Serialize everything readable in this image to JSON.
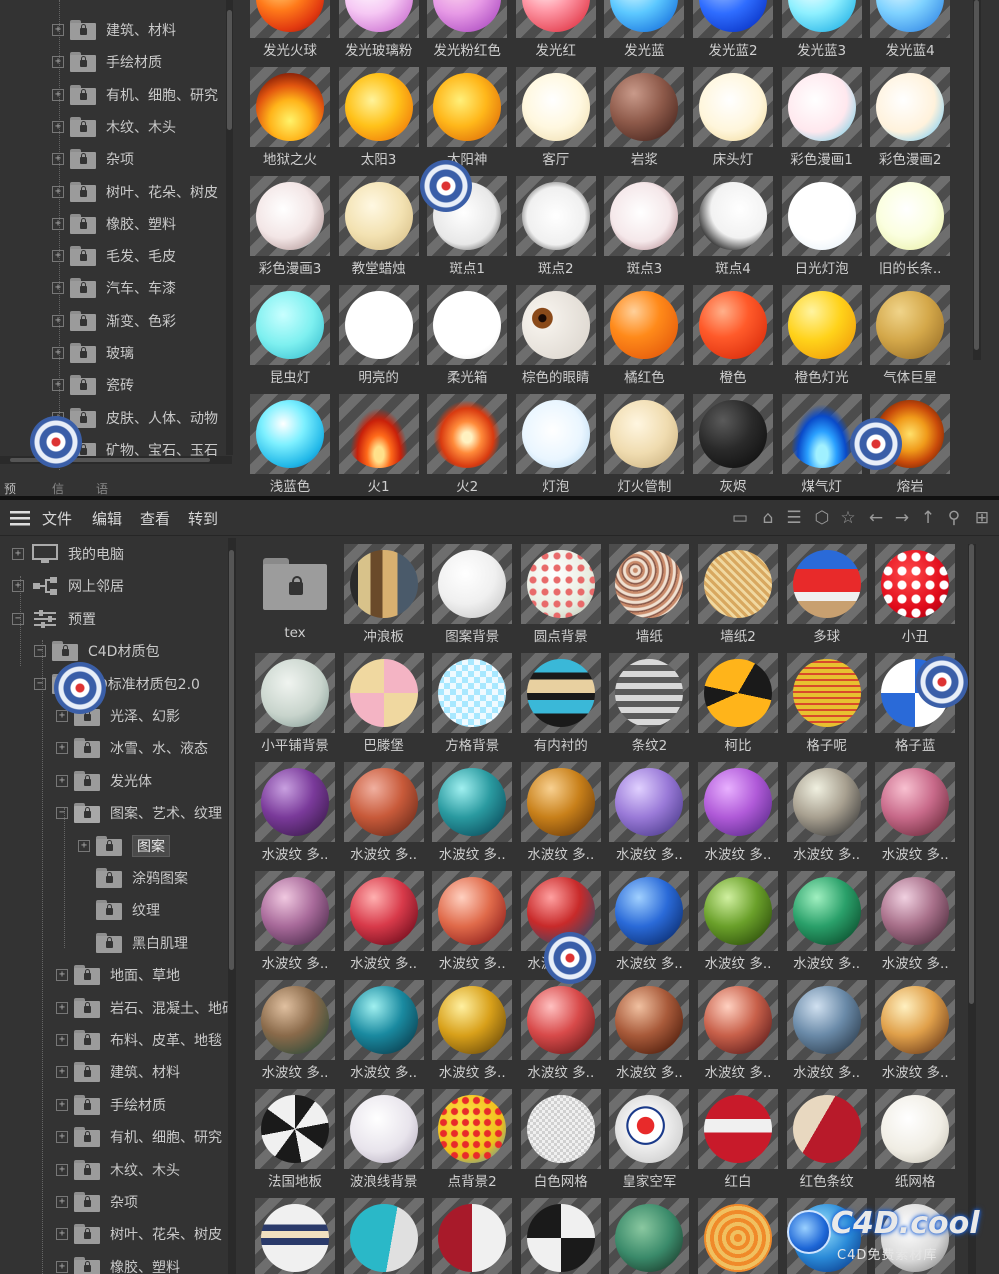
{
  "top": {
    "tree_items": [
      "建筑、材料",
      "手绘材质",
      "有机、细胞、研究",
      "木纹、木头",
      "杂项",
      "树叶、花朵、树皮",
      "橡胶、塑料",
      "毛发、毛皮",
      "汽车、车漆",
      "渐变、色彩",
      "玻璃",
      "瓷砖",
      "皮肤、人体、动物",
      "矿物、宝石、玉石"
    ],
    "bottom_tabs": [
      "预览",
      "信息",
      "语言"
    ],
    "materials": [
      {
        "label": "发光火球",
        "style": "radial-gradient(circle at 35% 30%,#ffe08a,#ff7a1a 40%,#e23a10 70%,#8a1005)"
      },
      {
        "label": "发光玻璃粉",
        "style": "radial-gradient(circle at 35% 30%,#fff,#f6c8f4 45%,#d27ed6 80%)"
      },
      {
        "label": "发光粉红色",
        "style": "radial-gradient(circle at 35% 30%,#fde,#e79ae6 45%,#b85bc8 80%)"
      },
      {
        "label": "发光红",
        "style": "radial-gradient(circle at 35% 30%,#fff,#ff9aa8 40%,#e23a4a 85%)"
      },
      {
        "label": "发光蓝",
        "style": "radial-gradient(circle at 35% 30%,#e8ffff,#5cc8ff 45%,#1c78e0 85%)"
      },
      {
        "label": "发光蓝2",
        "style": "radial-gradient(circle at 35% 30%,#a9c8ff,#2f6dff 45%,#0b36c8 85%)"
      },
      {
        "label": "发光蓝3",
        "style": "radial-gradient(circle at 35% 30%,#ffffff,#8ff0ff 45%,#2bb6e8 85%)"
      },
      {
        "label": "发光蓝4",
        "style": "radial-gradient(circle at 35% 30%,#e9fbff,#7fd2ff 45%,#3a8fe8 85%)"
      },
      {
        "label": "地狱之火",
        "style": "radial-gradient(circle at 50% 70%,#fff36a,#ffb41a 35%,#e2560f 60%,#6a0e05 90%)"
      },
      {
        "label": "太阳3",
        "style": "radial-gradient(circle at 40% 40%,#fff39a,#ffc21a 45%,#f07a0a 85%)"
      },
      {
        "label": "太阳神",
        "style": "radial-gradient(circle at 40% 40%,#fff07a,#ffb71a 45%,#e0700a 85%)"
      },
      {
        "label": "客厅",
        "style": "radial-gradient(circle at 45% 40%,#ffffff,#fff8e0 50%,#f2e2b8 85%)"
      },
      {
        "label": "岩浆",
        "style": "radial-gradient(circle at 35% 30%,#c99a8a,#8e5a4a 45%,#4e2a22 85%)"
      },
      {
        "label": "床头灯",
        "style": "radial-gradient(circle at 45% 40%,#ffffff,#fff6dc 55%,#f3dca0 90%)"
      },
      {
        "label": "彩色漫画1",
        "style": "radial-gradient(circle at 40% 40%,#ffffff,#ffe8ee 55%,#9ed7e8 80%,#ffb37a 90%)"
      },
      {
        "label": "彩色漫画2",
        "style": "radial-gradient(circle at 40% 40%,#ffffff,#fff2dc 55%,#9fd8f0 80%,#6aa8e8 90%)"
      },
      {
        "label": "彩色漫画3",
        "style": "radial-gradient(circle at 40% 40%,#ffffff,#f3e6e6 50%,#cdb8b8 72%,#4fc4c8 88%)"
      },
      {
        "label": "教堂蜡烛",
        "style": "radial-gradient(circle at 40% 35%,#fff8e2,#f3e2b2 50%,#d8c08a 88%)"
      },
      {
        "label": "斑点1",
        "style": "radial-gradient(circle at 45% 45%,#ffffff,#e8e8e8 60%,#2a2a2a 95%)"
      },
      {
        "label": "斑点2",
        "style": "radial-gradient(circle at 50% 50%,#ffffff,#f0f0f0 60%,#1a1a1a 95%)"
      },
      {
        "label": "斑点3",
        "style": "radial-gradient(circle at 45% 45%,#ffffff,#f5e8ea 55%,#b48a90 90%)"
      },
      {
        "label": "斑点4",
        "style": "radial-gradient(circle at 60% 40%,#ffffff,#f2f2f2 50%,#1e1e1e 80%)"
      },
      {
        "label": "日光灯泡",
        "style": "radial-gradient(circle at 45% 40%,#ffffff,#ffffff 55%,#e6f0f8 90%)"
      },
      {
        "label": "旧的长条..",
        "style": "radial-gradient(circle at 45% 40%,#ffffff,#fbffe0 50%,#e9f0a8 90%)"
      },
      {
        "label": "昆虫灯",
        "style": "radial-gradient(circle at 40% 35%,#c8ffff,#7ef0f0 50%,#3ac0d0 90%)"
      },
      {
        "label": "明亮的",
        "style": "radial-gradient(circle at 45% 40%,#ffffff,#ffffff 70%,#e8e8e8 95%)"
      },
      {
        "label": "柔光箱",
        "style": "radial-gradient(circle at 45% 40%,#ffffff,#ffffff 65%,#e2e2e2 95%)"
      },
      {
        "label": "棕色的眼睛",
        "style": "radial-gradient(circle at 30% 40%,#1a0a05 0 6%,#8a4a1a 7% 16%,#f4f0ea 17%,#dcd6ce 90%)"
      },
      {
        "label": "橘红色",
        "style": "radial-gradient(circle at 35% 30%,#ffd09a,#ff8a1a 40%,#e2560a 90%)"
      },
      {
        "label": "橙色",
        "style": "radial-gradient(circle at 35% 30%,#ffb08a,#ff5a2a 40%,#d82a0a 90%)"
      },
      {
        "label": "橙色灯光",
        "style": "radial-gradient(circle at 35% 30%,#fff4a0,#ffd21a 45%,#f09a0a 90%)"
      },
      {
        "label": "气体巨星",
        "style": "radial-gradient(circle at 35% 30%,#f0d48a,#d4a84a 45%,#9a7028 90%)"
      },
      {
        "label": "浅蓝色",
        "style": "radial-gradient(circle at 40% 35%,#ffffff,#7ef0ff 35%,#22b8e8 70%,#0a6ab8 95%)"
      },
      {
        "label": "火1",
        "style": "radial-gradient(ellipse at 50% 80%,#ffe08a 0 10%,#ff6a1a 25%,#c8200a 45%,transparent 60%)"
      },
      {
        "label": "火2",
        "style": "radial-gradient(ellipse at 50% 55%,#fff1c0 0 10%,#ff8a3a 30%,#d83a10 55%,transparent 70%)"
      },
      {
        "label": "灯泡",
        "style": "radial-gradient(circle at 45% 45%,#ffffff,#eaf6ff 55%,#b8d8f0 90%)"
      },
      {
        "label": "灯火管制",
        "style": "radial-gradient(circle at 40% 35%,#fff6e0,#f0dcb0 50%,#cdb483 90%)"
      },
      {
        "label": "灰烬",
        "style": "radial-gradient(circle at 35% 30%,#5a5a5a,#2a2a2a 45%,#0e0e0e 90%)"
      },
      {
        "label": "煤气灯",
        "style": "radial-gradient(ellipse at 50% 80%,#a0f0ff 0 12%,#2aa0ff 30%,#0a4ac8 50%,transparent 65%)"
      },
      {
        "label": "熔岩",
        "style": "radial-gradient(circle at 50% 50%,#ffe06a,#f09a1a 35%,#c84a0a 60%,#5a1a05 90%)"
      }
    ]
  },
  "menubar": {
    "items": [
      "文件",
      "编辑",
      "查看",
      "转到"
    ],
    "tool_icons": [
      "window-icon",
      "home-icon",
      "filter-icon",
      "cube-icon",
      "star-icon",
      "back-arrow-icon",
      "forward-arrow-icon",
      "up-arrow-icon",
      "search-icon",
      "add-icon"
    ],
    "tool_glyphs": [
      "▭",
      "⌂",
      "☰",
      "⬡",
      "☆",
      "←",
      "→",
      "↑",
      "⚲",
      "⊞"
    ]
  },
  "bottom": {
    "tree": [
      {
        "label": "我的电脑",
        "kind": "computer"
      },
      {
        "label": "网上邻居",
        "kind": "network"
      },
      {
        "label": "预置",
        "kind": "preset"
      },
      {
        "label": "C4D材质包",
        "kind": "folder"
      },
      {
        "label": "4D标准材质包2.0",
        "kind": "folder"
      },
      {
        "label": "光泽、幻影",
        "kind": "folder"
      },
      {
        "label": "冰雪、水、液态",
        "kind": "folder"
      },
      {
        "label": "发光体",
        "kind": "folder"
      },
      {
        "label": "图案、艺术、纹理",
        "kind": "folder-open"
      },
      {
        "label": "图案",
        "kind": "folder",
        "selected": true
      },
      {
        "label": "涂鸦图案",
        "kind": "folder"
      },
      {
        "label": "纹理",
        "kind": "folder"
      },
      {
        "label": "黑白肌理",
        "kind": "folder"
      },
      {
        "label": "地面、草地",
        "kind": "folder"
      },
      {
        "label": "岩石、混凝土、地砖",
        "kind": "folder"
      },
      {
        "label": "布料、皮革、地毯",
        "kind": "folder"
      },
      {
        "label": "建筑、材料",
        "kind": "folder"
      },
      {
        "label": "手绘材质",
        "kind": "folder"
      },
      {
        "label": "有机、细胞、研究",
        "kind": "folder"
      },
      {
        "label": "木纹、木头",
        "kind": "folder"
      },
      {
        "label": "杂项",
        "kind": "folder"
      },
      {
        "label": "树叶、花朵、树皮",
        "kind": "folder"
      },
      {
        "label": "橡胶、塑料",
        "kind": "folder"
      }
    ],
    "materials": [
      {
        "label": "tex",
        "folder": true
      },
      {
        "label": "冲浪板",
        "style": "linear-gradient(90deg,#2a2a2a 0 12%,#d8c28a 12% 30%,#6a4a2a 30% 48%,#d8b070 48% 70%,#4a5a6a 70%)"
      },
      {
        "label": "图案背景",
        "style": "radial-gradient(circle at 40% 35%,#ffffff,#f0f0f0 50%,#c8c8c8 90%)"
      },
      {
        "label": "圆点背景",
        "style": "radial-gradient(circle,#e86a6a 0 3px,transparent 4px) 0 0/12px 12px,radial-gradient(circle at 40% 35%,#fff,#e8ece0 60%,#b8c0b0)"
      },
      {
        "label": "墙纸",
        "style": "repeating-radial-gradient(circle at 30% 30%,#c88a6a 0 2px,#f0e0d0 3px 5px,#8a5a4a 6px 7px)"
      },
      {
        "label": "墙纸2",
        "style": "repeating-linear-gradient(45deg,#d8a860 0 3px,#f0d8a0 3px 6px),repeating-linear-gradient(-45deg,#a87030 0 3px,transparent 3px 6px)"
      },
      {
        "label": "多球",
        "style": "linear-gradient(180deg,#2a6ad8 0 28%,#e82a2a 28% 62%,#f0f0f0 62% 75%,#c8a070 75%)"
      },
      {
        "label": "小丑",
        "style": "radial-gradient(circle,#ffffff 0 4px,transparent 5px) 0 0/14px 14px,radial-gradient(circle at 40% 35%,#ff4a4a,#e00a1a 60%,#900010)"
      },
      {
        "label": "小平铺背景",
        "style": "radial-gradient(circle at 40% 35%,#f0f4f0,#c8d4cc 55%,#8aa09a 90%)"
      },
      {
        "label": "巴滕堡",
        "style": "conic-gradient(#f4b4c4 0 25%,#f0d8a0 25% 50%,#f4b4c4 50% 75%,#f0d8a0 75%)"
      },
      {
        "label": "方格背景",
        "style": "repeating-conic-gradient(#a8e8ff 0 25%,#f0faff 0 50%) 0 0/12px 12px"
      },
      {
        "label": "有内衬的",
        "style": "linear-gradient(180deg,#3ab8d8 0 20%,#1a1a1a 20% 30%,#e8d0a0 30% 50%,#1a1a1a 50% 60%,#3ab8d8 60% 80%,#1a1a1a 80%)"
      },
      {
        "label": "条纹2",
        "style": "repeating-linear-gradient(180deg,#d8d8d8 0 6px,#5a5a5a 6px 12px)"
      },
      {
        "label": "柯比",
        "style": "conic-gradient(from 30deg,#1a1a1a 0 20%,#ffb41a 20% 60%,#1a1a1a 60% 70%,#ffb41a 70%)"
      },
      {
        "label": "格子呢",
        "style": "repeating-linear-gradient(0deg,#e8c030 0 4px,#d84a2a 4px 6px),repeating-linear-gradient(90deg,#e8c030 0 4px,#d84a2a 4px 6px)"
      },
      {
        "label": "格子蓝",
        "style": "conic-gradient(#2a6ad8 0 25%,#ffffff 25% 50%,#2a6ad8 50% 75%,#ffffff 75%)"
      },
      {
        "label": "水波纹 多..",
        "style": "radial-gradient(circle at 35% 30%,#c8a0e0,#7a3a9a 45%,#3a1a4a 90%)"
      },
      {
        "label": "水波纹 多..",
        "style": "radial-gradient(circle at 35% 30%,#f0b0a0,#c85a3a 45%,#6a2a1a 90%)"
      },
      {
        "label": "水波纹 多..",
        "style": "radial-gradient(circle at 35% 30%,#a0f0f0,#2a9aa0 45%,#0a4a5a 90%)"
      },
      {
        "label": "水波纹 多..",
        "style": "radial-gradient(circle at 35% 30%,#f8d090,#c8801a 45%,#6a3a0a 90%)"
      },
      {
        "label": "水波纹 多..",
        "style": "radial-gradient(circle at 35% 30%,#e0d0ff,#9a7ad8 45%,#4a3a8a 90%)"
      },
      {
        "label": "水波纹 多..",
        "style": "radial-gradient(circle at 35% 30%,#e8b0ff,#b05ad8 45%,#5a2a8a 90%)"
      },
      {
        "label": "水波纹 多..",
        "style": "radial-gradient(circle at 35% 30%,#f0f0e0,#a8a090 45%,#3a3a3a 90%)"
      },
      {
        "label": "水波纹 多..",
        "style": "radial-gradient(circle at 35% 30%,#f8c0d0,#c86a8a 45%,#6a2a3a 90%)"
      },
      {
        "label": "水波纹 多..",
        "style": "radial-gradient(circle at 35% 30%,#f0c8e0,#a86a9a 45%,#4a2a4a 90%)"
      },
      {
        "label": "水波纹 多..",
        "style": "radial-gradient(circle at 35% 30%,#ffb0b0,#d83a4a 45%,#6a0a1a 90%)"
      },
      {
        "label": "水波纹 多..",
        "style": "radial-gradient(circle at 35% 30%,#ffd0c0,#e06a4a 45%,#8a1a1a 90%)"
      },
      {
        "label": "水波纹 多..",
        "style": "radial-gradient(circle at 35% 30%,#ffa0a0,#c82a2a 45%,#2a4a6a 90%)"
      },
      {
        "label": "水波纹 多..",
        "style": "radial-gradient(circle at 35% 30%,#a0d0ff,#2a6ad8 45%,#0a2a6a 90%)"
      },
      {
        "label": "水波纹 多..",
        "style": "radial-gradient(circle at 35% 30%,#d0f0a0,#6aa02a 45%,#2a4a0a 90%)"
      },
      {
        "label": "水波纹 多..",
        "style": "radial-gradient(circle at 35% 30%,#a0f0c0,#2aa06a 45%,#0a4a2a 90%)"
      },
      {
        "label": "水波纹 多..",
        "style": "radial-gradient(circle at 35% 30%,#f0d0e0,#a8708a 45%,#4a2a3a 90%)"
      },
      {
        "label": "水波纹 多..",
        "style": "radial-gradient(circle at 35% 30%,#e0c0a0,#8a6a4a 45%,#2a4a3a 90%)"
      },
      {
        "label": "水波纹 多..",
        "style": "radial-gradient(circle at 35% 30%,#a0f0f0,#1a8aa0 45%,#0a3a4a 90%)"
      },
      {
        "label": "水波纹 多..",
        "style": "radial-gradient(circle at 35% 30%,#fff0a0,#d8a01a 45%,#6a4a0a 90%)"
      },
      {
        "label": "水波纹 多..",
        "style": "radial-gradient(circle at 35% 30%,#ffc0c0,#d84a4a 45%,#6a1a1a 90%)"
      },
      {
        "label": "水波纹 多..",
        "style": "radial-gradient(circle at 35% 30%,#f0c0a0,#a85a3a 45%,#4a1a0a 90%)"
      },
      {
        "label": "水波纹 多..",
        "style": "radial-gradient(circle at 35% 30%,#ffd0c0,#c8604a 45%,#5a1a1a 90%)"
      },
      {
        "label": "水波纹 多..",
        "style": "radial-gradient(circle at 35% 30%,#d0e0f0,#6a8aa8 45%,#2a3a4a 90%)"
      },
      {
        "label": "水波纹 多..",
        "style": "radial-gradient(circle at 35% 30%,#fff0c0,#e0a04a 45%,#6a3a1a 90%)"
      },
      {
        "label": "法国地板",
        "style": "conic-gradient(#1a1a1a 0 10%,#f0f0f0 10% 22%,#1a1a1a 22% 35%,#f0f0f0 35% 47%,#1a1a1a 47% 60%,#f0f0f0 60% 72%,#1a1a1a 72% 85%,#f0f0f0 85%)"
      },
      {
        "label": "波浪线背景",
        "style": "radial-gradient(circle at 40% 35%,#ffffff,#e8e4ec 55%,#b8b0c0 90%)"
      },
      {
        "label": "点背景2",
        "style": "radial-gradient(circle,#e82a2a 0 3px,transparent 4px) 0 0/11px 11px,radial-gradient(circle at 40% 35%,#ffe04a,#f0c01a 60%,#2a8ad8)"
      },
      {
        "label": "白色网格",
        "style": "repeating-conic-gradient(#d0d0d0 0 25%,#f0f0f0 0 50%) 0 0/6px 6px"
      },
      {
        "label": "皇家空军",
        "style": "radial-gradient(circle at 45% 45%,#e82a2a 0 16%,#ffffff 17% 32%,#1a3a8a 33% 36%,#f0f0f0 37%,#c8c8c8 90%)"
      },
      {
        "label": "红白",
        "style": "linear-gradient(180deg,#c81a2a 0 35%,#f0f0f0 35% 55%,#c81a2a 55%)"
      },
      {
        "label": "红色条纹",
        "style": "linear-gradient(120deg,#e8d8c0 0 40%,#b81a2a 40%)"
      },
      {
        "label": "纸网格",
        "style": "radial-gradient(circle at 40% 35%,#ffffff,#f0ede4 55%,#c8c4b8 90%)"
      },
      {
        "label": "",
        "style": "linear-gradient(180deg,#f0f0f0 0 30%,#2a3a6a 30% 40%,#f0e0c0 40% 50%,#2a3a6a 50% 60%,#f0f0f0 60%)"
      },
      {
        "label": "",
        "style": "linear-gradient(100deg,#2ab8c8 0 60%,#e0e0e0 60%)"
      },
      {
        "label": "",
        "style": "linear-gradient(90deg,#a81a2a 0 50%,#f0f0f0 50%)"
      },
      {
        "label": "",
        "style": "conic-gradient(#f0f0f0 0 25%,#1a1a1a 25% 50%,#f0f0f0 50% 75%,#1a1a1a 75%)"
      },
      {
        "label": "",
        "style": "radial-gradient(circle at 40% 35%,#8ac8a0,#3a8a6a 50%,#1a3a2a 90%)"
      },
      {
        "label": "",
        "style": "repeating-radial-gradient(circle at 50% 50%,#f08a2a 0 4px,#f0c060 4px 8px)"
      },
      {
        "label": "",
        "style": "radial-gradient(circle at 40% 35%,#a0e8ff,#2a8ad8 50%,#0a3a8a 90%)"
      },
      {
        "label": "",
        "style": "radial-gradient(circle at 40% 35%,#ffffff,#d8d8d8 55%,#8a8a8a 90%)"
      }
    ]
  },
  "watermark": {
    "title": "C4D.cool",
    "subtitle": "C4D免费素材库"
  }
}
